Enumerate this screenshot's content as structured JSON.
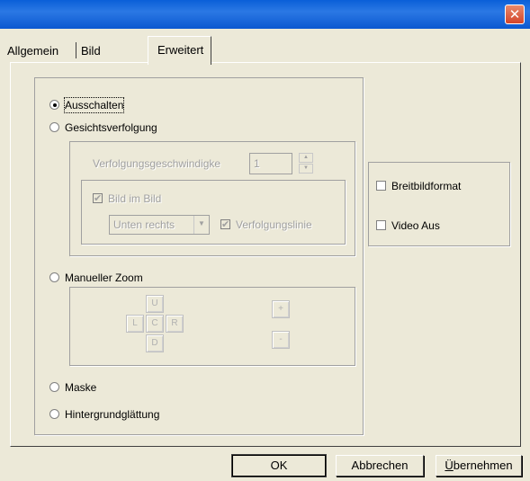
{
  "dialog": {
    "close_glyph": "✕",
    "tabs": [
      "Allgemein",
      "Bild",
      "Erweitert"
    ],
    "active_tab": "Erweitert"
  },
  "modes": {
    "off": "Ausschalten",
    "face_tracking": "Gesichtsverfolgung",
    "manual_zoom": "Manueller Zoom",
    "mask": "Maske",
    "background_smoothing": "Hintergrundglättung",
    "selected": "Ausschalten"
  },
  "tracking": {
    "speed_label": "Verfolgungsgeschwindigke",
    "speed_value": "1",
    "pip_label": "Bild im Bild",
    "pip_checked": true,
    "position_value": "Unten rechts",
    "trace_label": "Verfolgungslinie",
    "trace_checked": true
  },
  "zoom_pad": {
    "up": "U",
    "left": "L",
    "center": "C",
    "right": "R",
    "down": "D",
    "zoom_in": "+",
    "zoom_out": "-"
  },
  "options": {
    "widescreen": "Breitbildformat",
    "widescreen_checked": false,
    "video_off": "Video Aus",
    "video_off_checked": false
  },
  "buttons": {
    "ok": "OK",
    "cancel": "Abbrechen",
    "apply_mnemonic": "Ü",
    "apply_rest": "bernehmen"
  }
}
